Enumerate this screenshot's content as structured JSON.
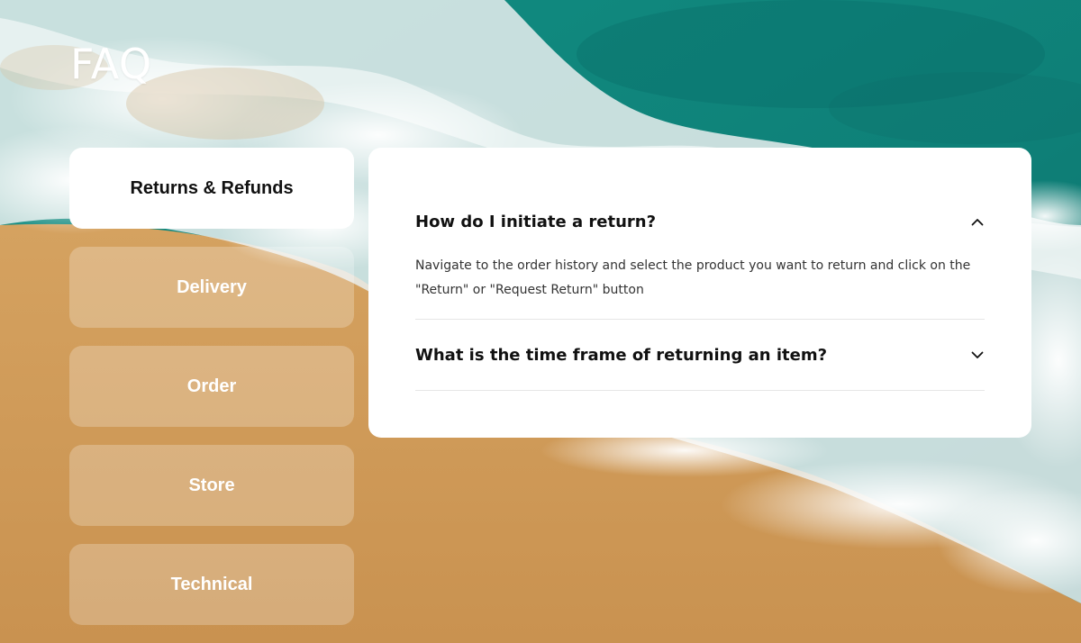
{
  "page": {
    "title": "FAQ"
  },
  "categories": [
    {
      "label": "Returns & Refunds",
      "active": true
    },
    {
      "label": "Delivery",
      "active": false
    },
    {
      "label": "Order",
      "active": false
    },
    {
      "label": "Store",
      "active": false
    },
    {
      "label": "Technical",
      "active": false
    }
  ],
  "faq": {
    "items": [
      {
        "question": "How do I initiate a return?",
        "answer": "Navigate to the order history and select the product you want to return and click on the \"Return\" or \"Request Return\" button",
        "expanded": true,
        "icon": "chevron-up-icon"
      },
      {
        "question": "What is the time frame of returning an item?",
        "answer": "",
        "expanded": false,
        "icon": "chevron-down-icon"
      }
    ]
  },
  "colors": {
    "sea": "#0f8a7e",
    "sea_deep": "#0a6a64",
    "foam": "#f4f7f8",
    "sand": "#cf9a55",
    "sand_light": "#d9aa68",
    "panel": "#ffffff",
    "active_tab_text": "#111111",
    "inactive_tab_text": "#ffffff"
  }
}
